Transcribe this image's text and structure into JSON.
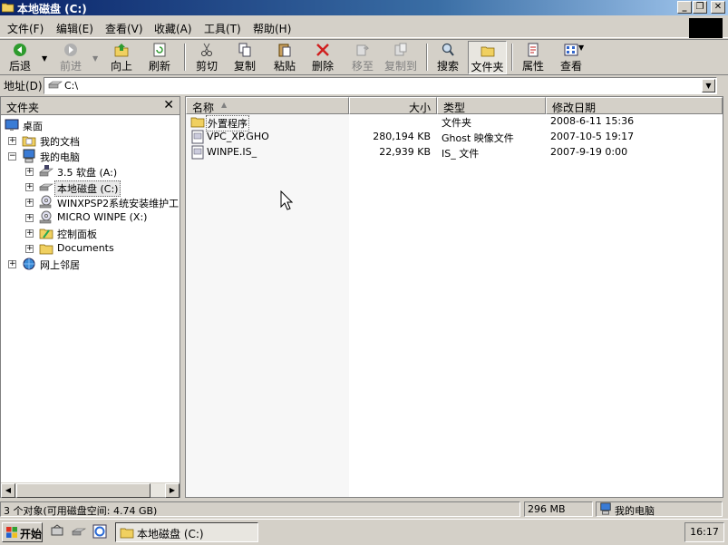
{
  "window": {
    "title": "本地磁盘 (C:)",
    "buttons": {
      "minimize": "_",
      "maximize": "❐",
      "close": "✕"
    }
  },
  "menubar": {
    "items": [
      "文件(F)",
      "编辑(E)",
      "查看(V)",
      "收藏(A)",
      "工具(T)",
      "帮助(H)"
    ]
  },
  "toolbar": {
    "back": "后退",
    "forward": "前进",
    "up": "向上",
    "refresh": "刷新",
    "cut": "剪切",
    "copy": "复制",
    "paste": "粘贴",
    "delete": "删除",
    "move_to": "移至",
    "copy_to": "复制到",
    "search": "搜索",
    "folders": "文件夹",
    "properties": "属性",
    "view": "查看"
  },
  "address": {
    "label": "地址(D)",
    "value": "C:\\"
  },
  "folder_pane": {
    "title": "文件夹",
    "close": "✕",
    "tree": [
      {
        "label": "桌面",
        "icon": "desktop-icon"
      },
      {
        "label": "我的文档",
        "icon": "my-documents-icon"
      },
      {
        "label": "我的电脑",
        "icon": "my-computer-icon"
      },
      {
        "label": "3.5 软盘 (A:)",
        "icon": "floppy-icon"
      },
      {
        "label": "本地磁盘 (C:)",
        "icon": "hard-disk-icon",
        "selected": true
      },
      {
        "label": "WINXPSP2系统安装维护工",
        "icon": "cd-drive-icon"
      },
      {
        "label": "MICRO WINPE (X:)",
        "icon": "cd-drive-icon"
      },
      {
        "label": "控制面板",
        "icon": "control-panel-icon"
      },
      {
        "label": "Documents",
        "icon": "folder-icon"
      },
      {
        "label": "网上邻居",
        "icon": "network-icon"
      }
    ]
  },
  "file_list": {
    "columns": {
      "name": "名称",
      "size": "大小",
      "type": "类型",
      "modified": "修改日期"
    },
    "rows": [
      {
        "name": "外置程序",
        "size": "",
        "type": "文件夹",
        "modified": "2008-6-11 15:36",
        "icon": "folder-icon"
      },
      {
        "name": "VPC_XP.GHO",
        "size": "280,194 KB",
        "type": "Ghost 映像文件",
        "modified": "2007-10-5 19:17",
        "icon": "file-icon"
      },
      {
        "name": "WINPE.IS_",
        "size": "22,939 KB",
        "type": "IS_ 文件",
        "modified": "2007-9-19 0:00",
        "icon": "file-icon"
      }
    ]
  },
  "statusbar": {
    "objects": "3 个对象(可用磁盘空间: 4.74 GB)",
    "size": "296 MB",
    "zone": "我的电脑"
  },
  "taskbar": {
    "start": "开始",
    "task_label": "本地磁盘 (C:)",
    "clock": "16:17"
  }
}
